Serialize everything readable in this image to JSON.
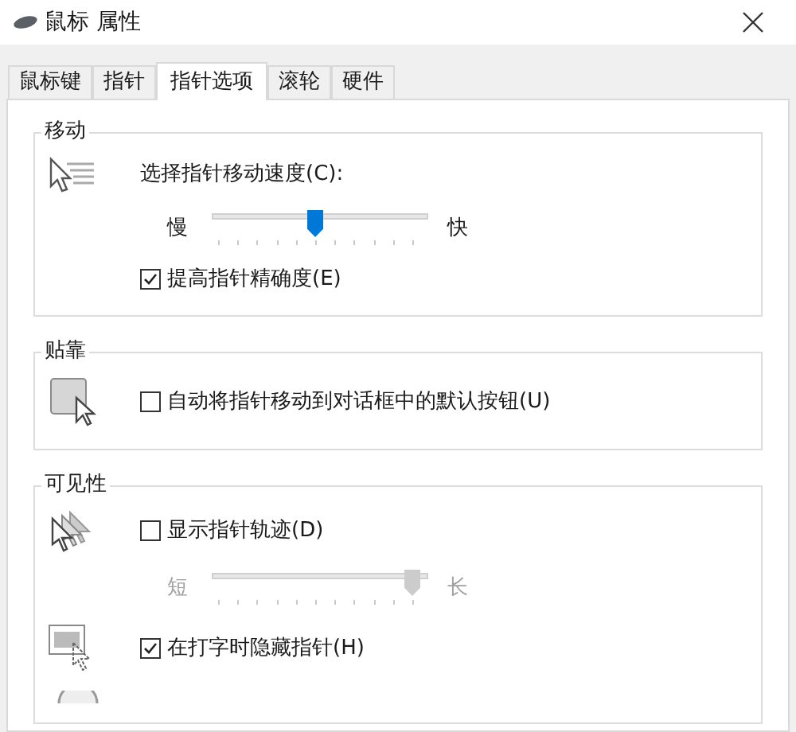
{
  "window": {
    "title": "鼠标 属性"
  },
  "tabs": [
    {
      "label": "鼠标键",
      "selected": false
    },
    {
      "label": "指针",
      "selected": false
    },
    {
      "label": "指针选项",
      "selected": true
    },
    {
      "label": "滚轮",
      "selected": false
    },
    {
      "label": "硬件",
      "selected": false
    }
  ],
  "groups": [
    {
      "title": "移动",
      "items": [
        {
          "kind": "label",
          "text": "选择指针移动速度(C):"
        },
        {
          "kind": "slider",
          "min_label": "慢",
          "max_label": "快",
          "level": 0.5,
          "disabled": false
        },
        {
          "kind": "checkbox",
          "label": "提高指针精确度(E)",
          "checked": true
        }
      ]
    },
    {
      "title": "贴靠",
      "items": [
        {
          "kind": "checkbox",
          "label": "自动将指针移动到对话框中的默认按钮(U)",
          "checked": false
        }
      ]
    },
    {
      "title": "可见性",
      "items": [
        {
          "kind": "checkbox",
          "label": "显示指针轨迹(D)",
          "checked": false
        },
        {
          "kind": "slider",
          "min_label": "短",
          "max_label": "长",
          "level": 1,
          "disabled": true
        },
        {
          "kind": "checkbox",
          "label": "在打字时隐藏指针(H)",
          "checked": true
        },
        {
          "kind": "partial"
        }
      ]
    }
  ]
}
